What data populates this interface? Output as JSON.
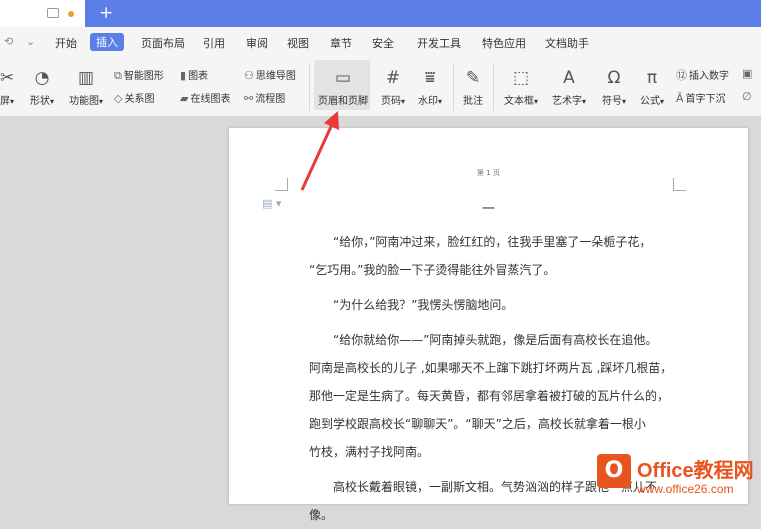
{
  "titlebar": {
    "new_tab_symbol": "+"
  },
  "menu": {
    "qa_items": [
      "⟲",
      "⌄"
    ],
    "items": [
      "开始",
      "插入",
      "页面布局",
      "引用",
      "审阅",
      "视图",
      "章节",
      "安全",
      "开发工具",
      "特色应用",
      "文档助手"
    ],
    "active": "插入"
  },
  "ribbon": {
    "screenshot_partial": "屏",
    "shapes": "形状",
    "icon_lib": "功能图",
    "smart_shape": "智能图形",
    "chart": "图表",
    "relation_chart": "关系图",
    "online_chart": "在线图表",
    "mind_map": "思维导图",
    "flowchart": "流程图",
    "header_footer": "页眉和页脚",
    "page_number": "页码",
    "watermark": "水印",
    "comment": "批注",
    "textbox": "文本框",
    "art_text": "艺术字",
    "symbol": "符号",
    "formula": "公式",
    "insert_number": "插入数字",
    "drop_cap": "首字下沉",
    "attachment_partial": "ð"
  },
  "document": {
    "header_label": "第 1 页",
    "page_number": "一",
    "paragraphs": [
      [
        "“给你，”阿南冲过来，脸红红的，往我手里塞了一朵栀子花，",
        "“乞巧用。”我的脸一下子烫得能往外冒蒸汽了。"
      ],
      [
        "“为什么给我？”我愣头愣脑地问。"
      ],
      [
        "“给你就给你——”阿南掉头就跑，像是后面有高校长在追他。",
        "阿南是高校长的儿子 ,如果哪天不上蹿下跳打坏两片瓦 ,踩坏几根苗，",
        "那他一定是生病了。每天黄昏，都有邻居拿着被打破的瓦片什么的，",
        "跑到学校跟高校长“聊聊天”。“聊天”之后，高校长就拿着一根小",
        "竹枝，满村子找阿南。"
      ],
      [
        "高校长戴着眼镜，一副斯文相。气势汹汹的样子跟他一点儿不像。"
      ]
    ]
  },
  "watermark": {
    "logo_letter": "O",
    "title": "Office教程网",
    "url": "www.office26.com"
  },
  "colors": {
    "accent": "#5b7fe6",
    "arrow": "#e83a3a",
    "watermark": "#e8541e"
  }
}
